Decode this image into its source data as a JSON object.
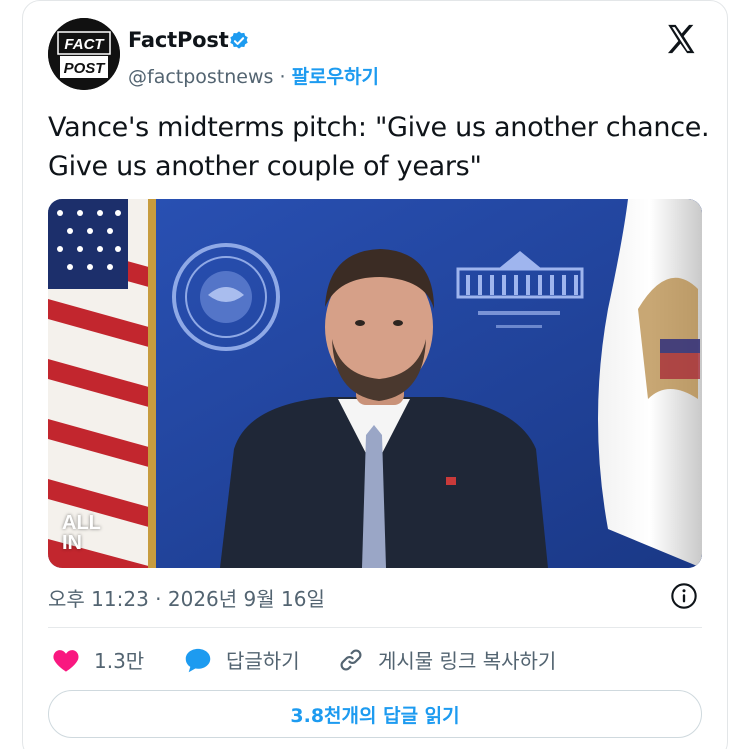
{
  "author": {
    "name": "FactPost",
    "handle": "@factpostnews",
    "separator": " · ",
    "follow_label": "팔로우하기",
    "avatar_lines": [
      "FACT",
      "POST"
    ]
  },
  "tweet": {
    "text": "Vance's midterms pitch: \"Give us another chance. Give us another couple of years\"",
    "timestamp": "오후 11:23 · 2026년 9월 16일"
  },
  "media": {
    "watermark_lines": [
      "ALL",
      "IN"
    ]
  },
  "actions": {
    "likes_count": "1.3만",
    "reply_label": "답글하기",
    "copy_link_label": "게시물 링크 복사하기"
  },
  "replies_button": {
    "label": "3.8천개의 답글 읽기"
  },
  "icons": {
    "verified": "verified-badge-icon",
    "x_logo": "x-logo-icon",
    "info": "info-icon",
    "like": "heart-icon",
    "reply": "speech-bubble-icon",
    "copy": "link-icon"
  },
  "colors": {
    "accent": "#1d9bf0",
    "like": "#f91880",
    "muted": "#536471",
    "text": "#0f1419"
  }
}
